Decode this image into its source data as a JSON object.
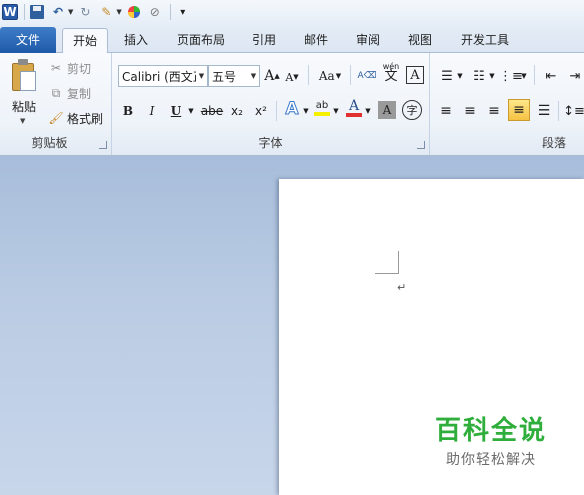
{
  "qat": {
    "logo": "W",
    "customize_icon": "▾"
  },
  "tabs": [
    "文件",
    "开始",
    "插入",
    "页面布局",
    "引用",
    "邮件",
    "审阅",
    "视图",
    "开发工具"
  ],
  "clipboard": {
    "paste": "粘贴",
    "cut": "剪切",
    "copy": "复制",
    "format_painter": "格式刷",
    "group_label": "剪贴板"
  },
  "font": {
    "family": "Calibri (西文正文)",
    "size": "五号",
    "grow": "A",
    "shrink": "A",
    "change_case": "Aa",
    "phonetic": "wén",
    "phonetic_char": "文",
    "char_border": "A",
    "bold": "B",
    "italic": "I",
    "underline": "U",
    "strikethrough": "abe",
    "subscript": "x₂",
    "superscript": "x²",
    "text_effect": "A",
    "highlight": "ab",
    "font_color": "A",
    "char_shading": "A",
    "enclose": "字",
    "group_label": "字体"
  },
  "paragraph": {
    "group_label": "段落"
  },
  "document": {
    "para_mark": "↵"
  },
  "watermark": {
    "title": "百科全说",
    "subtitle": "助你轻松解决"
  },
  "colors": {
    "file_tab": "#2b65b5",
    "watermark": "#2fae3b",
    "font_color_bar": "#e03030",
    "highlight_bar": "#f5f000"
  }
}
